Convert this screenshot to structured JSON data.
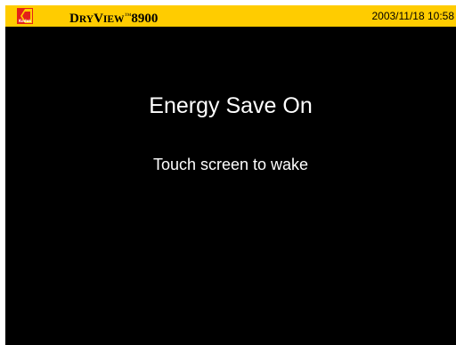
{
  "header": {
    "logo_text": "Kodak",
    "product_name_initial_1": "D",
    "product_name_rest_1": "RY",
    "product_name_initial_2": "V",
    "product_name_rest_2": "IEW",
    "trademark": "™",
    "model_number": "8900",
    "datetime": "2003/11/18 10:58",
    "background_color": "#ffcc00"
  },
  "main": {
    "status_title": "Energy Save On",
    "status_hint": "Touch screen to wake",
    "background_color": "#000000",
    "text_color": "#ffffff"
  },
  "icons": {
    "logo": "kodak-logo-icon"
  }
}
